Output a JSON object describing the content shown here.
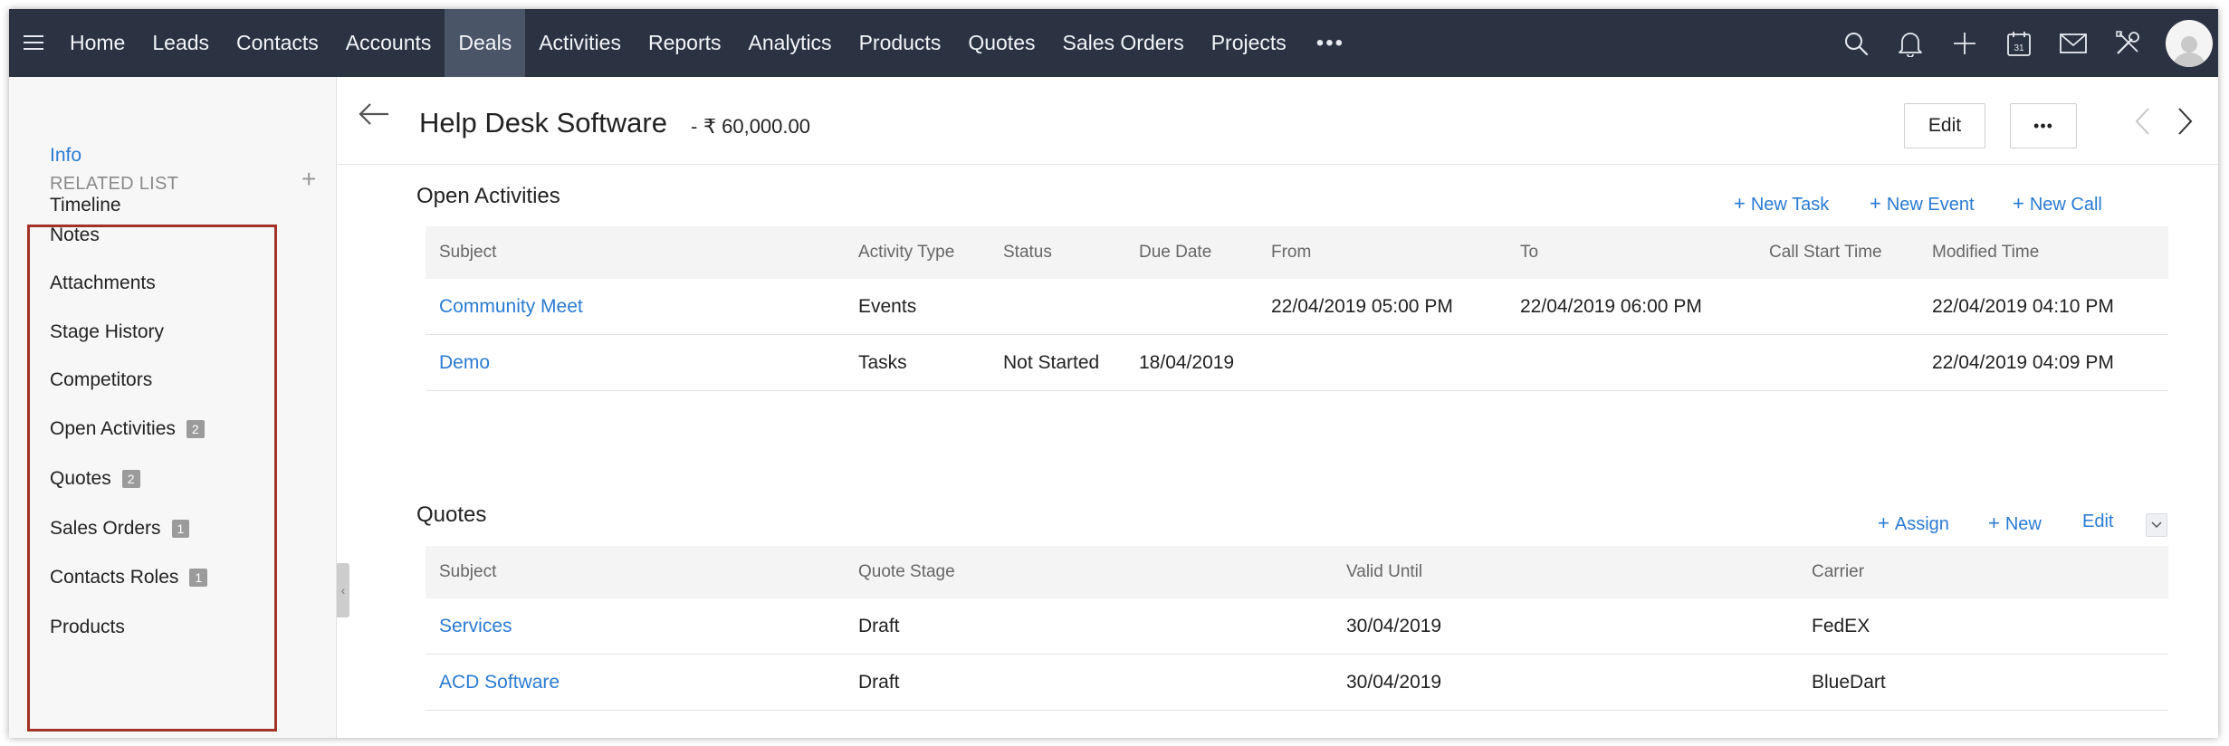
{
  "nav": {
    "items": [
      {
        "label": "Home"
      },
      {
        "label": "Leads"
      },
      {
        "label": "Contacts"
      },
      {
        "label": "Accounts"
      },
      {
        "label": "Deals",
        "active": true
      },
      {
        "label": "Activities"
      },
      {
        "label": "Reports"
      },
      {
        "label": "Analytics"
      },
      {
        "label": "Products"
      },
      {
        "label": "Quotes"
      },
      {
        "label": "Sales Orders"
      },
      {
        "label": "Projects"
      }
    ],
    "more_label": "•••",
    "icons": [
      "search-icon",
      "bell-icon",
      "plus-icon",
      "calendar-icon",
      "mail-icon",
      "tools-icon",
      "avatar"
    ],
    "calendar_day": "31",
    "colors": {
      "bar": "#2b3343",
      "active": "#4b5568"
    }
  },
  "sidebar": {
    "info": "Info",
    "timeline": "Timeline",
    "related_title": "RELATED LIST",
    "add_label": "+",
    "items": [
      {
        "label": "Notes",
        "count": ""
      },
      {
        "label": "Attachments",
        "count": ""
      },
      {
        "label": "Stage History",
        "count": ""
      },
      {
        "label": "Competitors",
        "count": ""
      },
      {
        "label": "Open Activities",
        "count": "2"
      },
      {
        "label": "Quotes",
        "count": "2"
      },
      {
        "label": "Sales Orders",
        "count": "1"
      },
      {
        "label": "Contacts Roles",
        "count": "1"
      },
      {
        "label": "Products",
        "count": ""
      }
    ],
    "highlight_color": "#a33128"
  },
  "header": {
    "title": "Help Desk Software",
    "separator": "-",
    "amount": "₹ 60,000.00",
    "edit_label": "Edit",
    "more_label": "•••"
  },
  "open_activities": {
    "title": "Open Activities",
    "actions": [
      "New Task",
      "New Event",
      "New Call"
    ],
    "columns": [
      "Subject",
      "Activity Type",
      "Status",
      "Due Date",
      "From",
      "To",
      "Call Start Time",
      "Modified Time"
    ],
    "rows": [
      [
        "Community Meet",
        "Events",
        "",
        "",
        "22/04/2019 05:00 PM",
        "22/04/2019 06:00 PM",
        "",
        "22/04/2019 04:10 PM"
      ],
      [
        "Demo",
        "Tasks",
        "Not Started",
        "18/04/2019",
        "",
        "",
        "",
        "22/04/2019 04:09 PM"
      ]
    ]
  },
  "quotes": {
    "title": "Quotes",
    "actions": [
      "Assign",
      "New"
    ],
    "edit_label": "Edit",
    "columns": [
      "Subject",
      "Quote Stage",
      "Valid Until",
      "Carrier"
    ],
    "rows": [
      [
        "Services",
        "Draft",
        "30/04/2019",
        "FedEX"
      ],
      [
        "ACD Software",
        "Draft",
        "30/04/2019",
        "BlueDart"
      ]
    ]
  },
  "accent_color": "#2a7bd3"
}
